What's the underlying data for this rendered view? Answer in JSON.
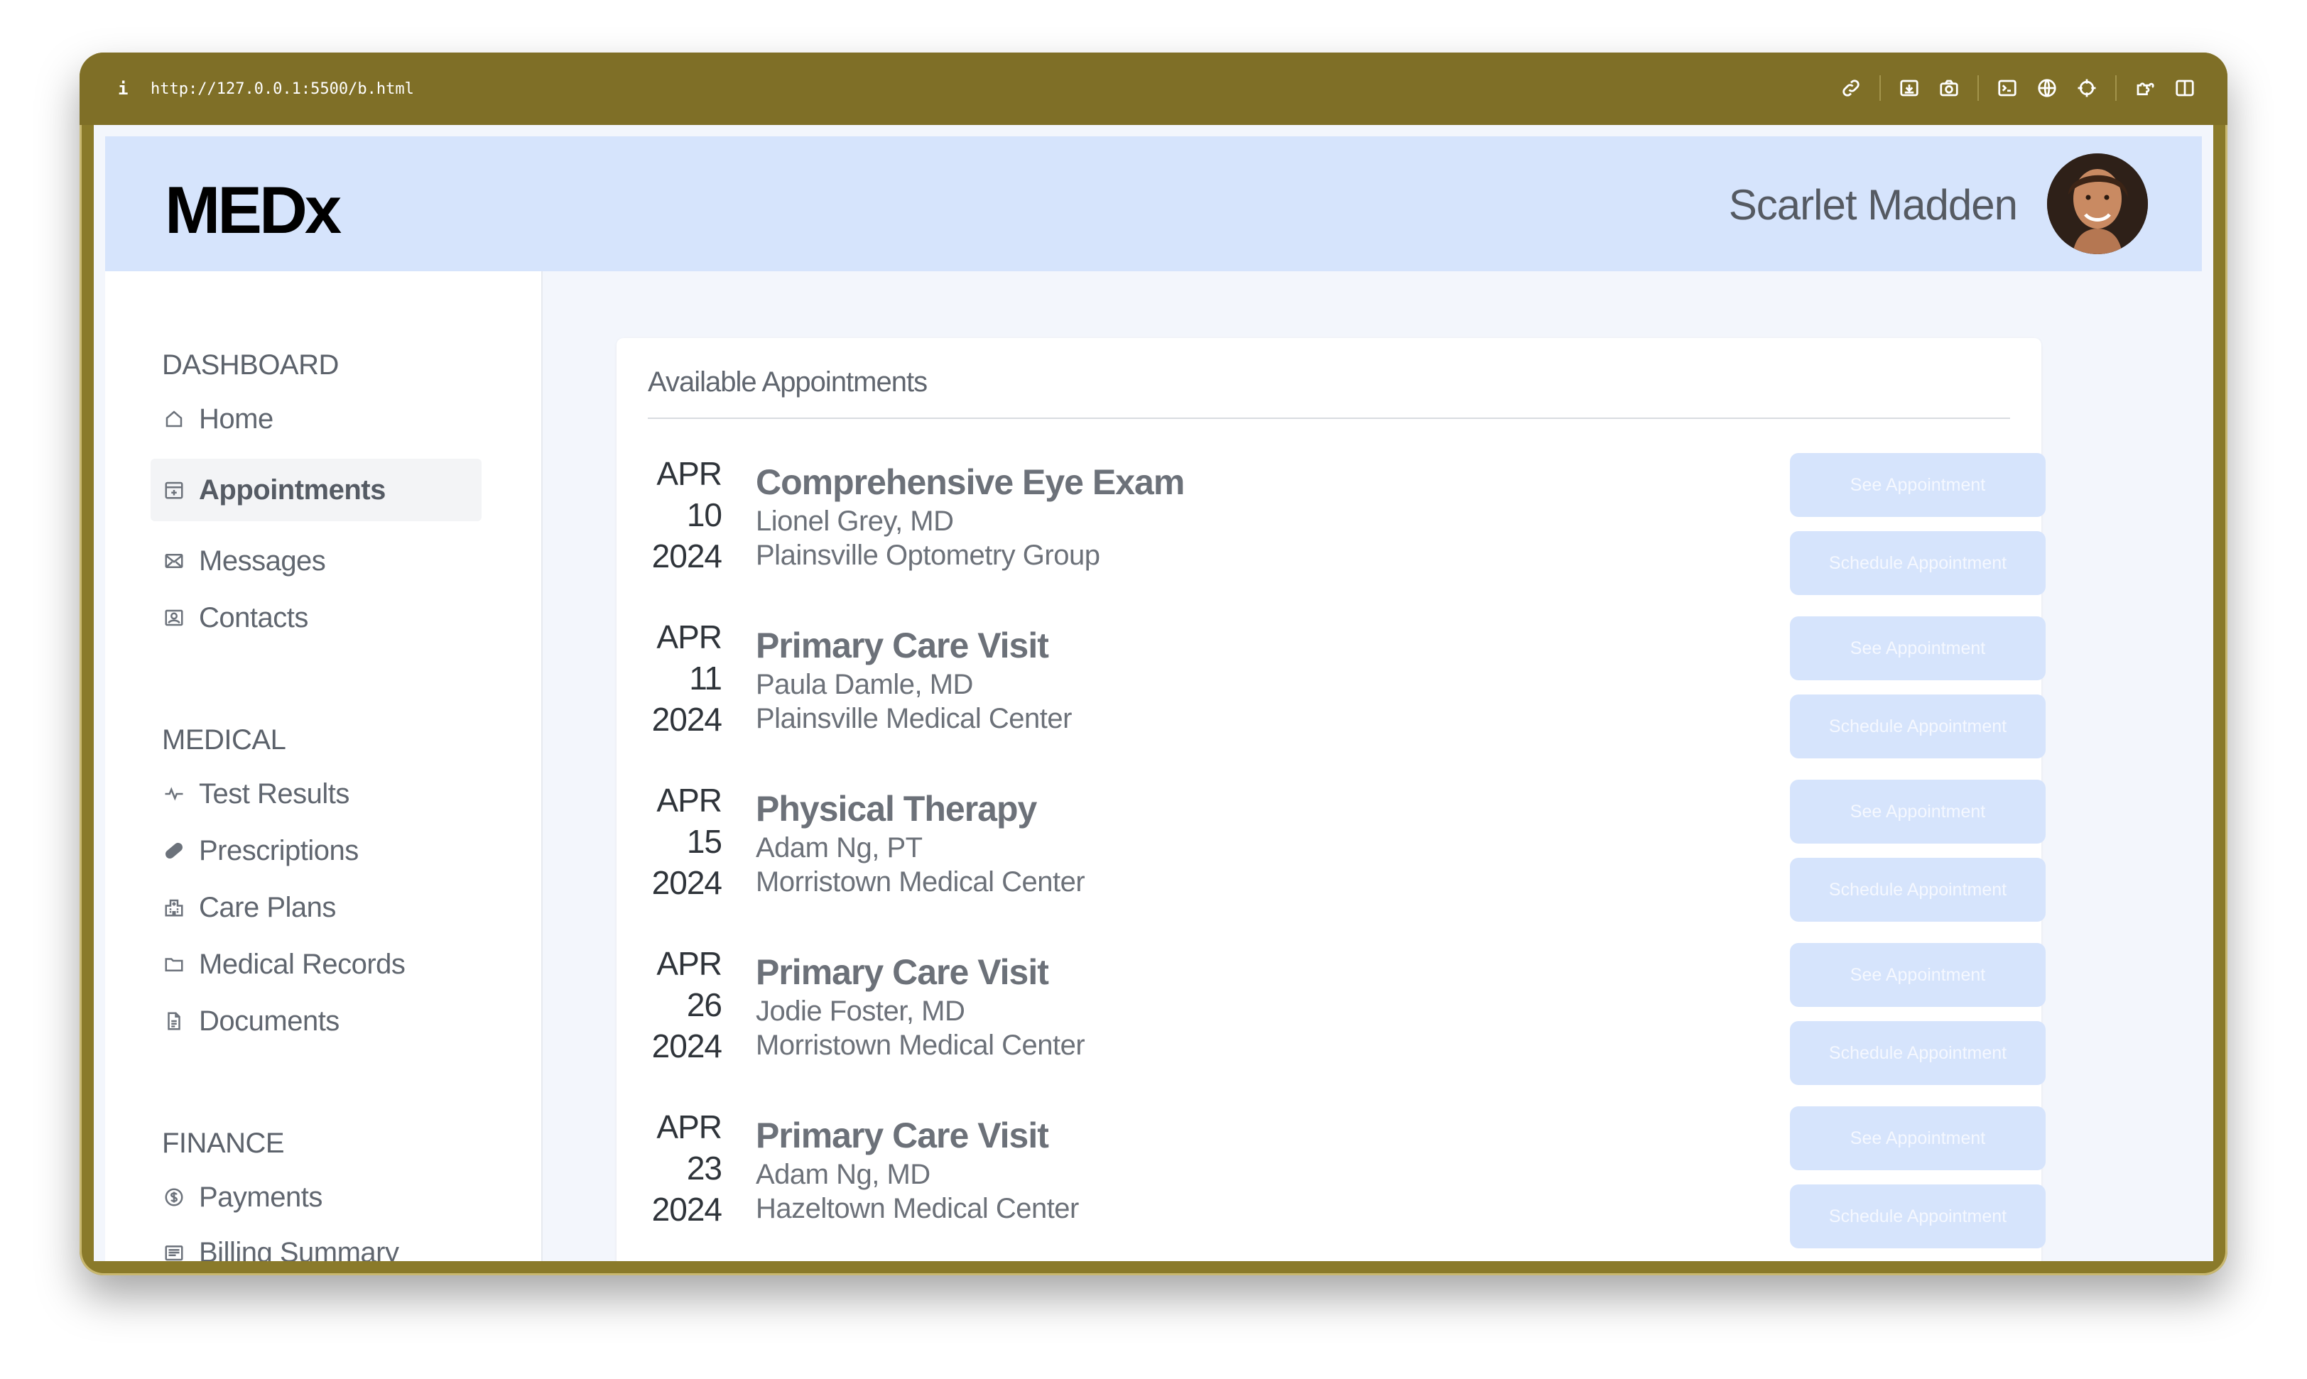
{
  "browser": {
    "info_icon": "i",
    "url": "http://127.0.0.1:5500/b.html",
    "toolbar_icons": [
      "link-icon",
      "download-icon",
      "camera-icon",
      "terminal-icon",
      "globe-icon",
      "crosshair-icon",
      "extension-icon",
      "sidebar-icon"
    ]
  },
  "header": {
    "logo": "MEDx",
    "user_name": "Scarlet Madden"
  },
  "sidebar": {
    "sections": [
      {
        "title": "DASHBOARD",
        "items": [
          {
            "label": "Home",
            "icon": "home-icon"
          },
          {
            "label": "Appointments",
            "icon": "calendar-plus-icon",
            "active": true
          },
          {
            "label": "Messages",
            "icon": "envelope-icon"
          },
          {
            "label": "Contacts",
            "icon": "contact-card-icon"
          }
        ]
      },
      {
        "title": "MEDICAL",
        "items": [
          {
            "label": "Test Results",
            "icon": "pulse-icon"
          },
          {
            "label": "Prescriptions",
            "icon": "pill-icon"
          },
          {
            "label": "Care Plans",
            "icon": "hospital-icon"
          },
          {
            "label": "Medical Records",
            "icon": "folder-icon"
          },
          {
            "label": "Documents",
            "icon": "document-icon"
          }
        ]
      },
      {
        "title": "FINANCE",
        "items": [
          {
            "label": "Payments",
            "icon": "dollar-circle-icon"
          },
          {
            "label": "Billing Summary",
            "icon": "receipt-icon"
          }
        ]
      }
    ]
  },
  "main": {
    "title": "Available Appointments",
    "see_label": "See Appointment",
    "schedule_label": "Schedule Appointment",
    "appointments": [
      {
        "month": "APR",
        "day": "10",
        "year": "2024",
        "title": "Comprehensive Eye Exam",
        "doctor": "Lionel Grey, MD",
        "location": "Plainsville Optometry Group"
      },
      {
        "month": "APR",
        "day": "11",
        "year": "2024",
        "title": "Primary Care Visit",
        "doctor": "Paula Damle, MD",
        "location": "Plainsville Medical Center"
      },
      {
        "month": "APR",
        "day": "15",
        "year": "2024",
        "title": "Physical Therapy",
        "doctor": "Adam Ng, PT",
        "location": "Morristown Medical Center"
      },
      {
        "month": "APR",
        "day": "26",
        "year": "2024",
        "title": "Primary Care Visit",
        "doctor": "Jodie Foster, MD",
        "location": "Morristown Medical Center"
      },
      {
        "month": "APR",
        "day": "23",
        "year": "2024",
        "title": "Primary Care Visit",
        "doctor": "Adam Ng, MD",
        "location": "Hazeltown Medical Center"
      }
    ]
  },
  "colors": {
    "header_bg": "#d6e4fc",
    "button_bg": "#d6e4fc",
    "titlebar_bg": "#7f6f27"
  }
}
